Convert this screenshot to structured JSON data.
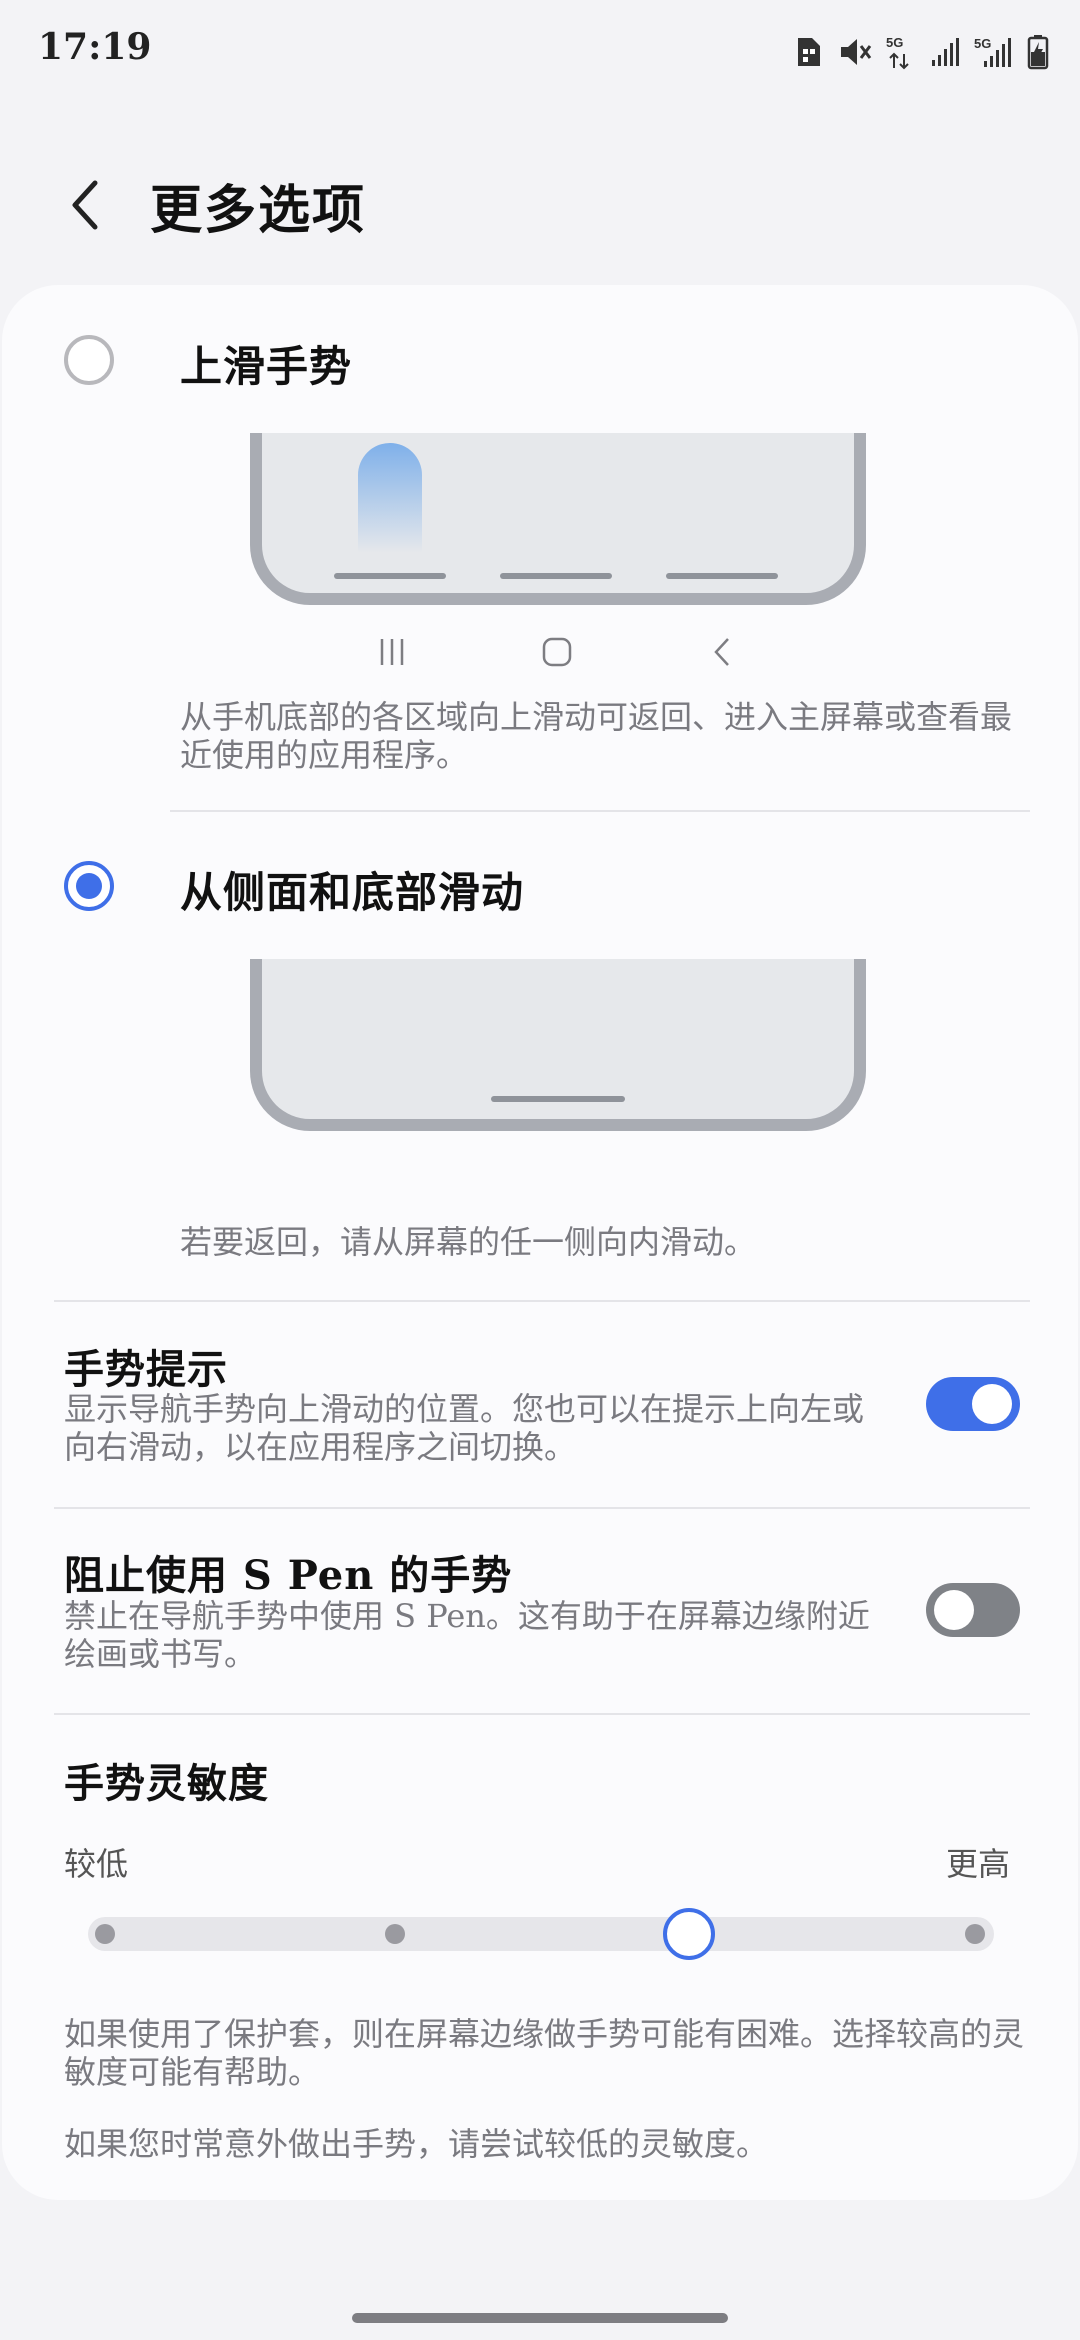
{
  "status_bar": {
    "time": "17:19",
    "icons": [
      "sim-card-icon",
      "mute-icon",
      "5g-data-icon",
      "signal-icon",
      "5g-signal-icon",
      "battery-charging-icon"
    ],
    "net1": "5G",
    "net2": "5G"
  },
  "header": {
    "back_icon": "chevron-left-icon",
    "title": "更多选项"
  },
  "options": {
    "swipe_up": {
      "label": "上滑手势",
      "selected": false,
      "description": "从手机底部的各区域向上滑动可返回、进入主屏幕或查看最近使用的应用程序。",
      "nav_icons": [
        "recents-icon",
        "home-icon",
        "back-icon"
      ]
    },
    "side_bottom": {
      "label": "从侧面和底部滑动",
      "selected": true,
      "description": "若要返回，请从屏幕的任一侧向内滑动。"
    }
  },
  "settings": {
    "gesture_hint": {
      "title": "手势提示",
      "subtitle": "显示导航手势向上滑动的位置。您也可以在提示上向左或向右滑动，以在应用程序之间切换。",
      "enabled": true
    },
    "block_spen": {
      "title": "阻止使用 S Pen 的手势",
      "subtitle": "禁止在导航手势中使用 S Pen。这有助于在屏幕边缘附近绘画或书写。",
      "enabled": false
    },
    "sensitivity": {
      "title": "手势灵敏度",
      "low_label": "较低",
      "high_label": "更高",
      "steps": 5,
      "value_index": 2,
      "note1": "如果使用了保护套，则在屏幕边缘做手势可能有困难。选择较高的灵敏度可能有帮助。",
      "note2": "如果您时常意外做出手势，请尝试较低的灵敏度。"
    }
  },
  "colors": {
    "accent": "#3f6fe8",
    "background": "#f3f3f6",
    "card": "#fbfbfd",
    "secondary_text": "#7a7a80"
  }
}
